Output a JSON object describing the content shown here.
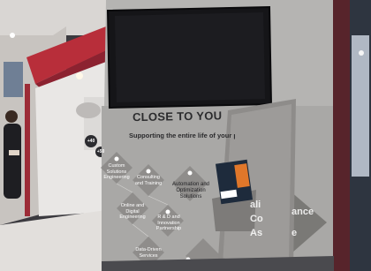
{
  "panel": {
    "heading": "CLOSE TO YOU",
    "subheading": "Supporting the entire life of your project"
  },
  "diamonds": [
    {
      "label": "Custom Solutions Engineering"
    },
    {
      "label": "Consulting and Training"
    },
    {
      "label": "Automation and Optimization Solutions"
    },
    {
      "label": "Online and Digital Engineering"
    },
    {
      "label": "R & D and Innovation Partnership"
    },
    {
      "label": "Data-Driven Services"
    }
  ],
  "badges": [
    {
      "label": "+40"
    },
    {
      "label": "+50"
    }
  ],
  "partial_text": {
    "line1": "ali",
    "line1_right": "ance",
    "line2": "Co",
    "line3": "As",
    "line3_right": "e"
  }
}
